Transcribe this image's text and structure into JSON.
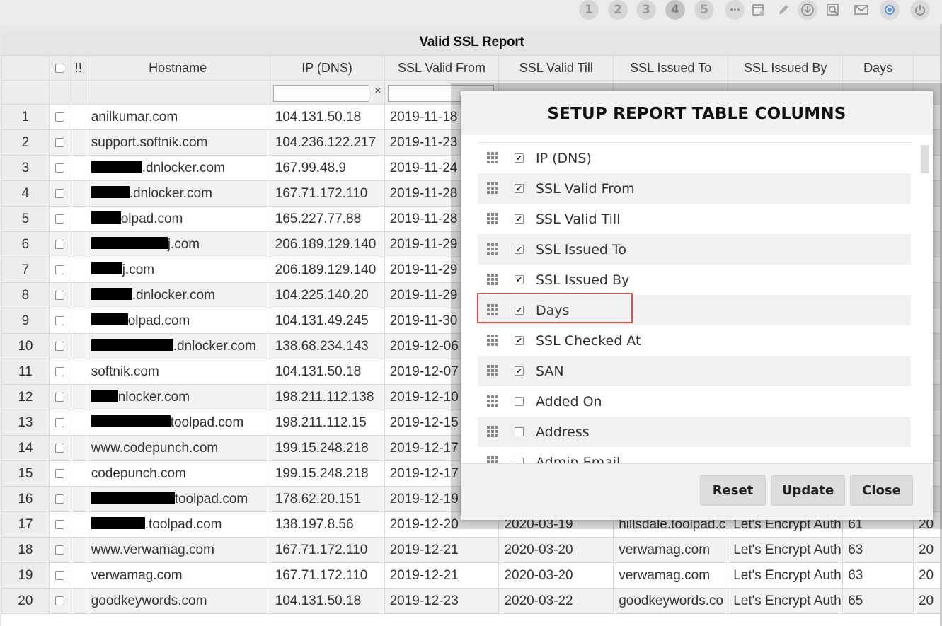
{
  "toolbar": {
    "pages": [
      "1",
      "2",
      "3",
      "4",
      "5"
    ],
    "active_page": "4",
    "more_glyph": "•••",
    "icons": [
      "calendar-settings-icon",
      "pencil-icon",
      "download-icon",
      "preview-icon",
      "email-icon",
      "refresh-icon",
      "power-icon"
    ]
  },
  "report": {
    "title": "Valid SSL Report",
    "columns": [
      "",
      "",
      "!!",
      "Hostname",
      "IP (DNS)",
      "SSL Valid From",
      "SSL Valid Till",
      "SSL Issued To",
      "SSL Issued By",
      "Days",
      ""
    ],
    "rows": [
      {
        "n": "1",
        "host_pre": "",
        "redact": 0,
        "host": "anilkumar.com",
        "ip": "104.131.50.18",
        "from": "2019-11-18",
        "till": "",
        "to": "",
        "by": "",
        "days": "",
        "extra": ""
      },
      {
        "n": "2",
        "host_pre": "",
        "redact": 0,
        "host": "support.softnik.com",
        "ip": "104.236.122.217",
        "from": "2019-11-23",
        "till": "",
        "to": "",
        "by": "",
        "days": "",
        "extra": ""
      },
      {
        "n": "3",
        "host_pre": "",
        "redact": 72,
        "host": ".dnlocker.com",
        "ip": "167.99.48.9",
        "from": "2019-11-24",
        "till": "",
        "to": "",
        "by": "",
        "days": "",
        "extra": ""
      },
      {
        "n": "4",
        "host_pre": "",
        "redact": 54,
        "host": ".dnlocker.com",
        "ip": "167.71.172.110",
        "from": "2019-11-28",
        "till": "",
        "to": "",
        "by": "",
        "days": "",
        "extra": ""
      },
      {
        "n": "5",
        "host_pre": "",
        "redact": 42,
        "host": "olpad.com",
        "ip": "165.227.77.88",
        "from": "2019-11-28",
        "till": "",
        "to": "",
        "by": "",
        "days": "",
        "extra": ""
      },
      {
        "n": "6",
        "host_pre": "",
        "redact": 108,
        "host": "j.com",
        "ip": "206.189.129.140",
        "from": "2019-11-29",
        "till": "",
        "to": "",
        "by": "",
        "days": "",
        "extra": ""
      },
      {
        "n": "7",
        "host_pre": "",
        "redact": 44,
        "host": "j.com",
        "ip": "206.189.129.140",
        "from": "2019-11-29",
        "till": "",
        "to": "",
        "by": "",
        "days": "",
        "extra": ""
      },
      {
        "n": "8",
        "host_pre": "",
        "redact": 58,
        "host": ".dnlocker.com",
        "ip": "104.225.140.20",
        "from": "2019-11-29",
        "till": "",
        "to": "",
        "by": "",
        "days": "",
        "extra": ""
      },
      {
        "n": "9",
        "host_pre": "",
        "redact": 52,
        "host": "olpad.com",
        "ip": "104.131.49.245",
        "from": "2019-11-30",
        "till": "",
        "to": "",
        "by": "",
        "days": "",
        "extra": ""
      },
      {
        "n": "10",
        "host_pre": "",
        "redact": 116,
        "host": ".dnlocker.com",
        "ip": "138.68.234.143",
        "from": "2019-12-06",
        "till": "",
        "to": "",
        "by": "",
        "days": "",
        "extra": ""
      },
      {
        "n": "11",
        "host_pre": "",
        "redact": 0,
        "host": "softnik.com",
        "ip": "104.131.50.18",
        "from": "2019-12-07",
        "till": "",
        "to": "",
        "by": "",
        "days": "",
        "extra": ""
      },
      {
        "n": "12",
        "host_pre": "",
        "redact": 38,
        "host": "nlocker.com",
        "ip": "198.211.112.138",
        "from": "2019-12-10",
        "till": "",
        "to": "",
        "by": "",
        "days": "",
        "extra": ""
      },
      {
        "n": "13",
        "host_pre": "",
        "redact": 112,
        "host": "toolpad.com",
        "ip": "198.211.112.15",
        "from": "2019-12-15",
        "till": "",
        "to": "",
        "by": "",
        "days": "",
        "extra": ""
      },
      {
        "n": "14",
        "host_pre": "",
        "redact": 0,
        "host": "www.codepunch.com",
        "ip": "199.15.248.218",
        "from": "2019-12-17",
        "till": "",
        "to": "",
        "by": "",
        "days": "",
        "extra": ""
      },
      {
        "n": "15",
        "host_pre": "",
        "redact": 0,
        "host": "codepunch.com",
        "ip": "199.15.248.218",
        "from": "2019-12-17",
        "till": "",
        "to": "",
        "by": "",
        "days": "",
        "extra": ""
      },
      {
        "n": "16",
        "host_pre": "",
        "redact": 118,
        "host": "toolpad.com",
        "ip": "178.62.20.151",
        "from": "2019-12-19",
        "till": "",
        "to": "",
        "by": "",
        "days": "",
        "extra": ""
      },
      {
        "n": "17",
        "host_pre": "",
        "redact": 76,
        "host": ".toolpad.com",
        "ip": "138.197.8.56",
        "from": "2019-12-20",
        "till": "2020-03-19",
        "to": "hillsdale.toolpad.c",
        "by": "Let's Encrypt Auth",
        "days": "61",
        "extra": "20"
      },
      {
        "n": "18",
        "host_pre": "",
        "redact": 0,
        "host": "www.verwamag.com",
        "ip": "167.71.172.110",
        "from": "2019-12-21",
        "till": "2020-03-20",
        "to": "verwamag.com",
        "by": "Let's Encrypt Auth",
        "days": "63",
        "extra": "20"
      },
      {
        "n": "19",
        "host_pre": "",
        "redact": 0,
        "host": "verwamag.com",
        "ip": "167.71.172.110",
        "from": "2019-12-21",
        "till": "2020-03-20",
        "to": "verwamag.com",
        "by": "Let's Encrypt Auth",
        "days": "63",
        "extra": "20"
      },
      {
        "n": "20",
        "host_pre": "",
        "redact": 0,
        "host": "goodkeywords.com",
        "ip": "104.131.50.18",
        "from": "2019-12-23",
        "till": "2020-03-22",
        "to": "goodkeywords.co",
        "by": "Let's Encrypt Auth",
        "days": "65",
        "extra": "20"
      }
    ]
  },
  "modal": {
    "title": "SETUP REPORT TABLE COLUMNS",
    "items": [
      {
        "label": "IP (DNS)",
        "checked": true
      },
      {
        "label": "SSL Valid From",
        "checked": true
      },
      {
        "label": "SSL Valid Till",
        "checked": true
      },
      {
        "label": "SSL Issued To",
        "checked": true
      },
      {
        "label": "SSL Issued By",
        "checked": true
      },
      {
        "label": "Days",
        "checked": true
      },
      {
        "label": "SSL Checked At",
        "checked": true
      },
      {
        "label": "SAN",
        "checked": true
      },
      {
        "label": "Added On",
        "checked": false
      },
      {
        "label": "Address",
        "checked": false
      },
      {
        "label": "Admin Email",
        "checked": false
      }
    ],
    "buttons": {
      "reset": "Reset",
      "update": "Update",
      "close": "Close"
    }
  }
}
